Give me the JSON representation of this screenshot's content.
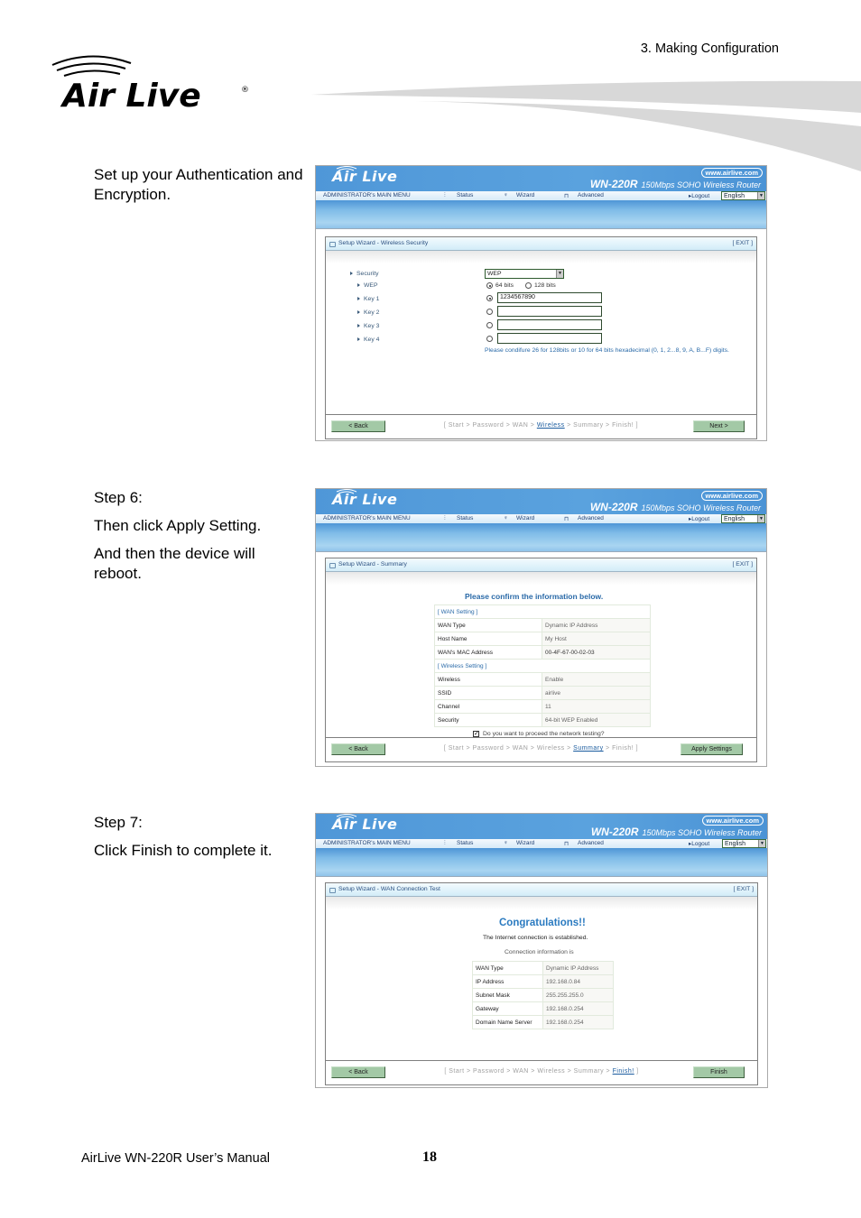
{
  "header": {
    "section": "3.  Making  Configuration",
    "brand": "Air Live"
  },
  "steps": [
    {
      "lines": [
        "Set up your Authentication and Encryption."
      ]
    },
    {
      "lines": [
        "Step 6:",
        "Then click Apply Setting.",
        "And then the device will reboot."
      ]
    },
    {
      "lines": [
        "Step 7:",
        "Click Finish to complete it."
      ]
    }
  ],
  "router": {
    "logo": "Air Live",
    "url": "www.airlive.com",
    "model": "WN-220R",
    "model_desc": "150Mbps SOHO Wireless Router",
    "nav": {
      "main_menu": "ADMINISTRATOR's MAIN MENU",
      "status": "Status",
      "wizard": "Wizard",
      "advanced": "Advanced",
      "logout": "Logout",
      "language": "English"
    },
    "exit": "[ EXIT ]",
    "back": "< Back",
    "breadcrumb": [
      "Start",
      "Password",
      "WAN",
      "Wireless",
      "Summary",
      "Finish!"
    ]
  },
  "screen1": {
    "title": "Setup Wizard - Wireless Security",
    "labels": {
      "security": "Security",
      "wep": "WEP",
      "key1": "Key 1",
      "key2": "Key 2",
      "key3": "Key 3",
      "key4": "Key 4"
    },
    "security_value": "WEP",
    "bits_64": "64 bits",
    "bits_128": "128 bits",
    "selected_bits": "64 bits",
    "key1_value": "1234567890",
    "key2_value": "",
    "key3_value": "",
    "key4_value": "",
    "selected_key": "Key 1",
    "note": "Please condifure 26 for 128bits or 10 for 64 bits hexadecimal (0, 1, 2...8, 9, A, B...F) digits.",
    "current_step": "Wireless",
    "next": "Next >"
  },
  "screen2": {
    "title": "Setup Wizard - Summary",
    "heading": "Please confirm the information below.",
    "wan_section": "[ WAN Setting ]",
    "wan_rows": [
      {
        "k": "WAN Type",
        "v": "Dynamic IP Address"
      },
      {
        "k": "Host Name",
        "v": "My Host"
      },
      {
        "k": "WAN's MAC Address",
        "v": "00-4F-67-00-02-03"
      }
    ],
    "wireless_section": "[ Wireless Setting ]",
    "wireless_rows": [
      {
        "k": "Wireless",
        "v": "Enable"
      },
      {
        "k": "SSID",
        "v": "airlive"
      },
      {
        "k": "Channel",
        "v": "11"
      },
      {
        "k": "Security",
        "v": "64-bit WEP Enabled"
      }
    ],
    "checkbox_label": "Do you want to proceed the network testing?",
    "checkbox_checked": true,
    "current_step": "Summary",
    "apply": "Apply Settings"
  },
  "screen3": {
    "title": "Setup Wizard - WAN Connection Test",
    "congrats": "Congratulations!!",
    "established": "The Internet connection is established.",
    "conn_info": "Connection information is",
    "rows": [
      {
        "k": "WAN Type",
        "v": "Dynamic IP Address"
      },
      {
        "k": "IP Address",
        "v": "192.168.0.84"
      },
      {
        "k": "Subnet Mask",
        "v": "255.255.255.0"
      },
      {
        "k": "Gateway",
        "v": "192.168.0.254"
      },
      {
        "k": "Domain Name Server",
        "v": "192.168.0.254"
      }
    ],
    "current_step": "Finish!",
    "finish": "Finish"
  },
  "footer": {
    "manual": "AirLive WN-220R User’s Manual",
    "page": "18"
  }
}
